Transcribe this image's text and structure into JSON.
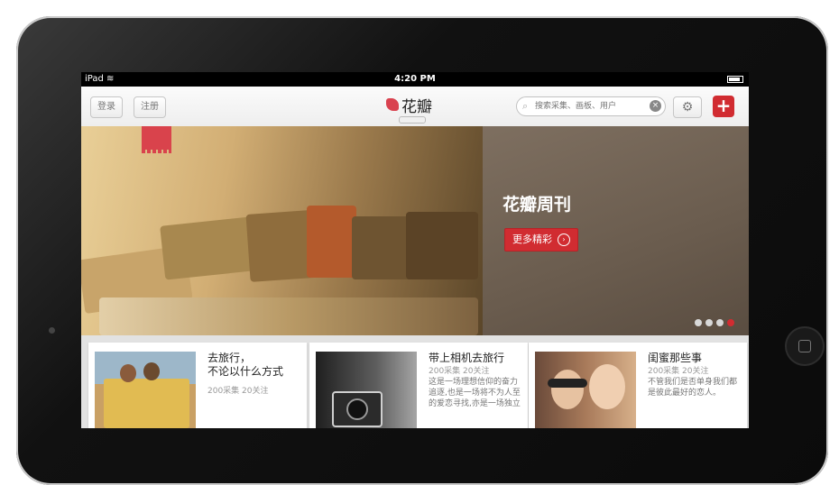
{
  "statusbar": {
    "device": "iPad",
    "time": "4:20 PM"
  },
  "topbar": {
    "login_label": "登录",
    "register_label": "注册",
    "logo_text": "花瓣",
    "search_placeholder": "搜索采集、画板、用户",
    "add_label": "+"
  },
  "hero": {
    "title": "花瓣周刊",
    "button_label": "更多精彩",
    "pager_total": 4,
    "pager_active": 4
  },
  "cards": [
    {
      "title": "去旅行，\n不论以什么方式",
      "meta": "200采集  20关注",
      "desc": ""
    },
    {
      "title": "带上相机去旅行",
      "meta": "200采集  20关注",
      "desc": "这是一场理想信仰的奋力追逐,也是一场将不为人至的爱恋寻找,亦是一场独立自我的灵魂对话"
    },
    {
      "title": "闺蜜那些事",
      "meta": "200采集  20关注",
      "desc": "不管我们是否单身我们都是彼此最好的恋人。"
    }
  ],
  "colors": {
    "accent": "#d12c31",
    "brand": "#d9424f"
  }
}
